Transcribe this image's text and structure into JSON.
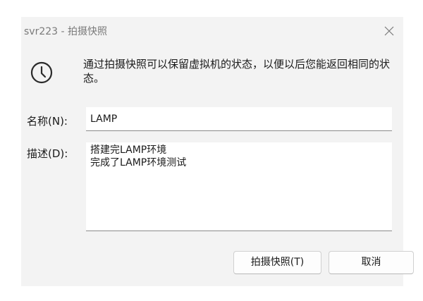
{
  "window": {
    "title": "svr223 - 拍摄快照",
    "close_icon": "close-icon"
  },
  "info": {
    "icon": "clock-icon",
    "message": "通过拍摄快照可以保留虚拟机的状态，以便以后您能返回相同的状态。"
  },
  "form": {
    "name_label": "名称(N):",
    "name_value": "LAMP",
    "description_label": "描述(D):",
    "description_value": "搭建完LAMP环境\n完成了LAMP环境测试"
  },
  "buttons": {
    "snapshot_label": "拍摄快照(T)",
    "cancel_label": "取消"
  },
  "colors": {
    "dialog_background": "#f3f3f3",
    "title_text": "#7a7a7a",
    "icon_stroke": "#2b2b2b"
  }
}
